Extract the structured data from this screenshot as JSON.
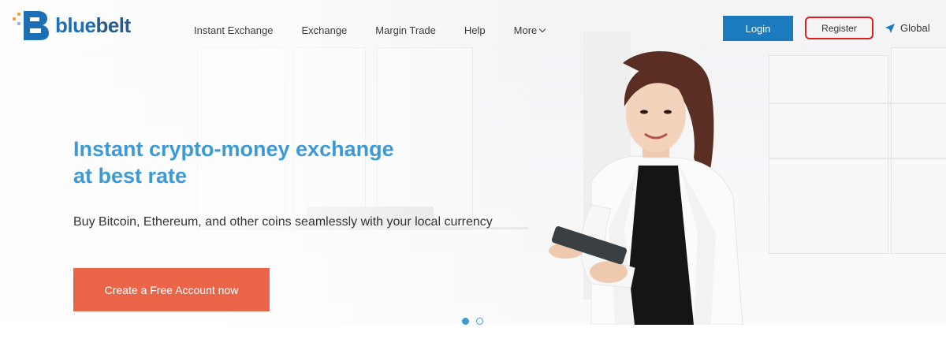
{
  "brand": {
    "name_part1": "blue",
    "name_part2": "belt",
    "logo_icon": "bluebelt-b-logo-icon"
  },
  "nav": {
    "items": [
      {
        "label": "Instant Exchange"
      },
      {
        "label": "Exchange"
      },
      {
        "label": "Margin Trade"
      },
      {
        "label": "Help"
      },
      {
        "label": "More",
        "icon": "chevron-down-icon"
      }
    ]
  },
  "header": {
    "login_label": "Login",
    "register_label": "Register",
    "region_label": "Global",
    "region_icon": "location-arrow-icon"
  },
  "hero": {
    "headline_line1": "Instant crypto-money exchange",
    "headline_line2": "at best rate",
    "subheadline": "Buy Bitcoin, Ethereum, and other coins seamlessly with your local currency",
    "cta_label": "Create a Free Account now",
    "image": "woman-holding-tablet-photo"
  },
  "carousel": {
    "slide_count": 2,
    "active_index": 0
  },
  "colors": {
    "primary_blue": "#1c7bbf",
    "headline_blue": "#3c9ad6",
    "cta_orange": "#ea6448",
    "register_highlight": "#e21b1b"
  }
}
